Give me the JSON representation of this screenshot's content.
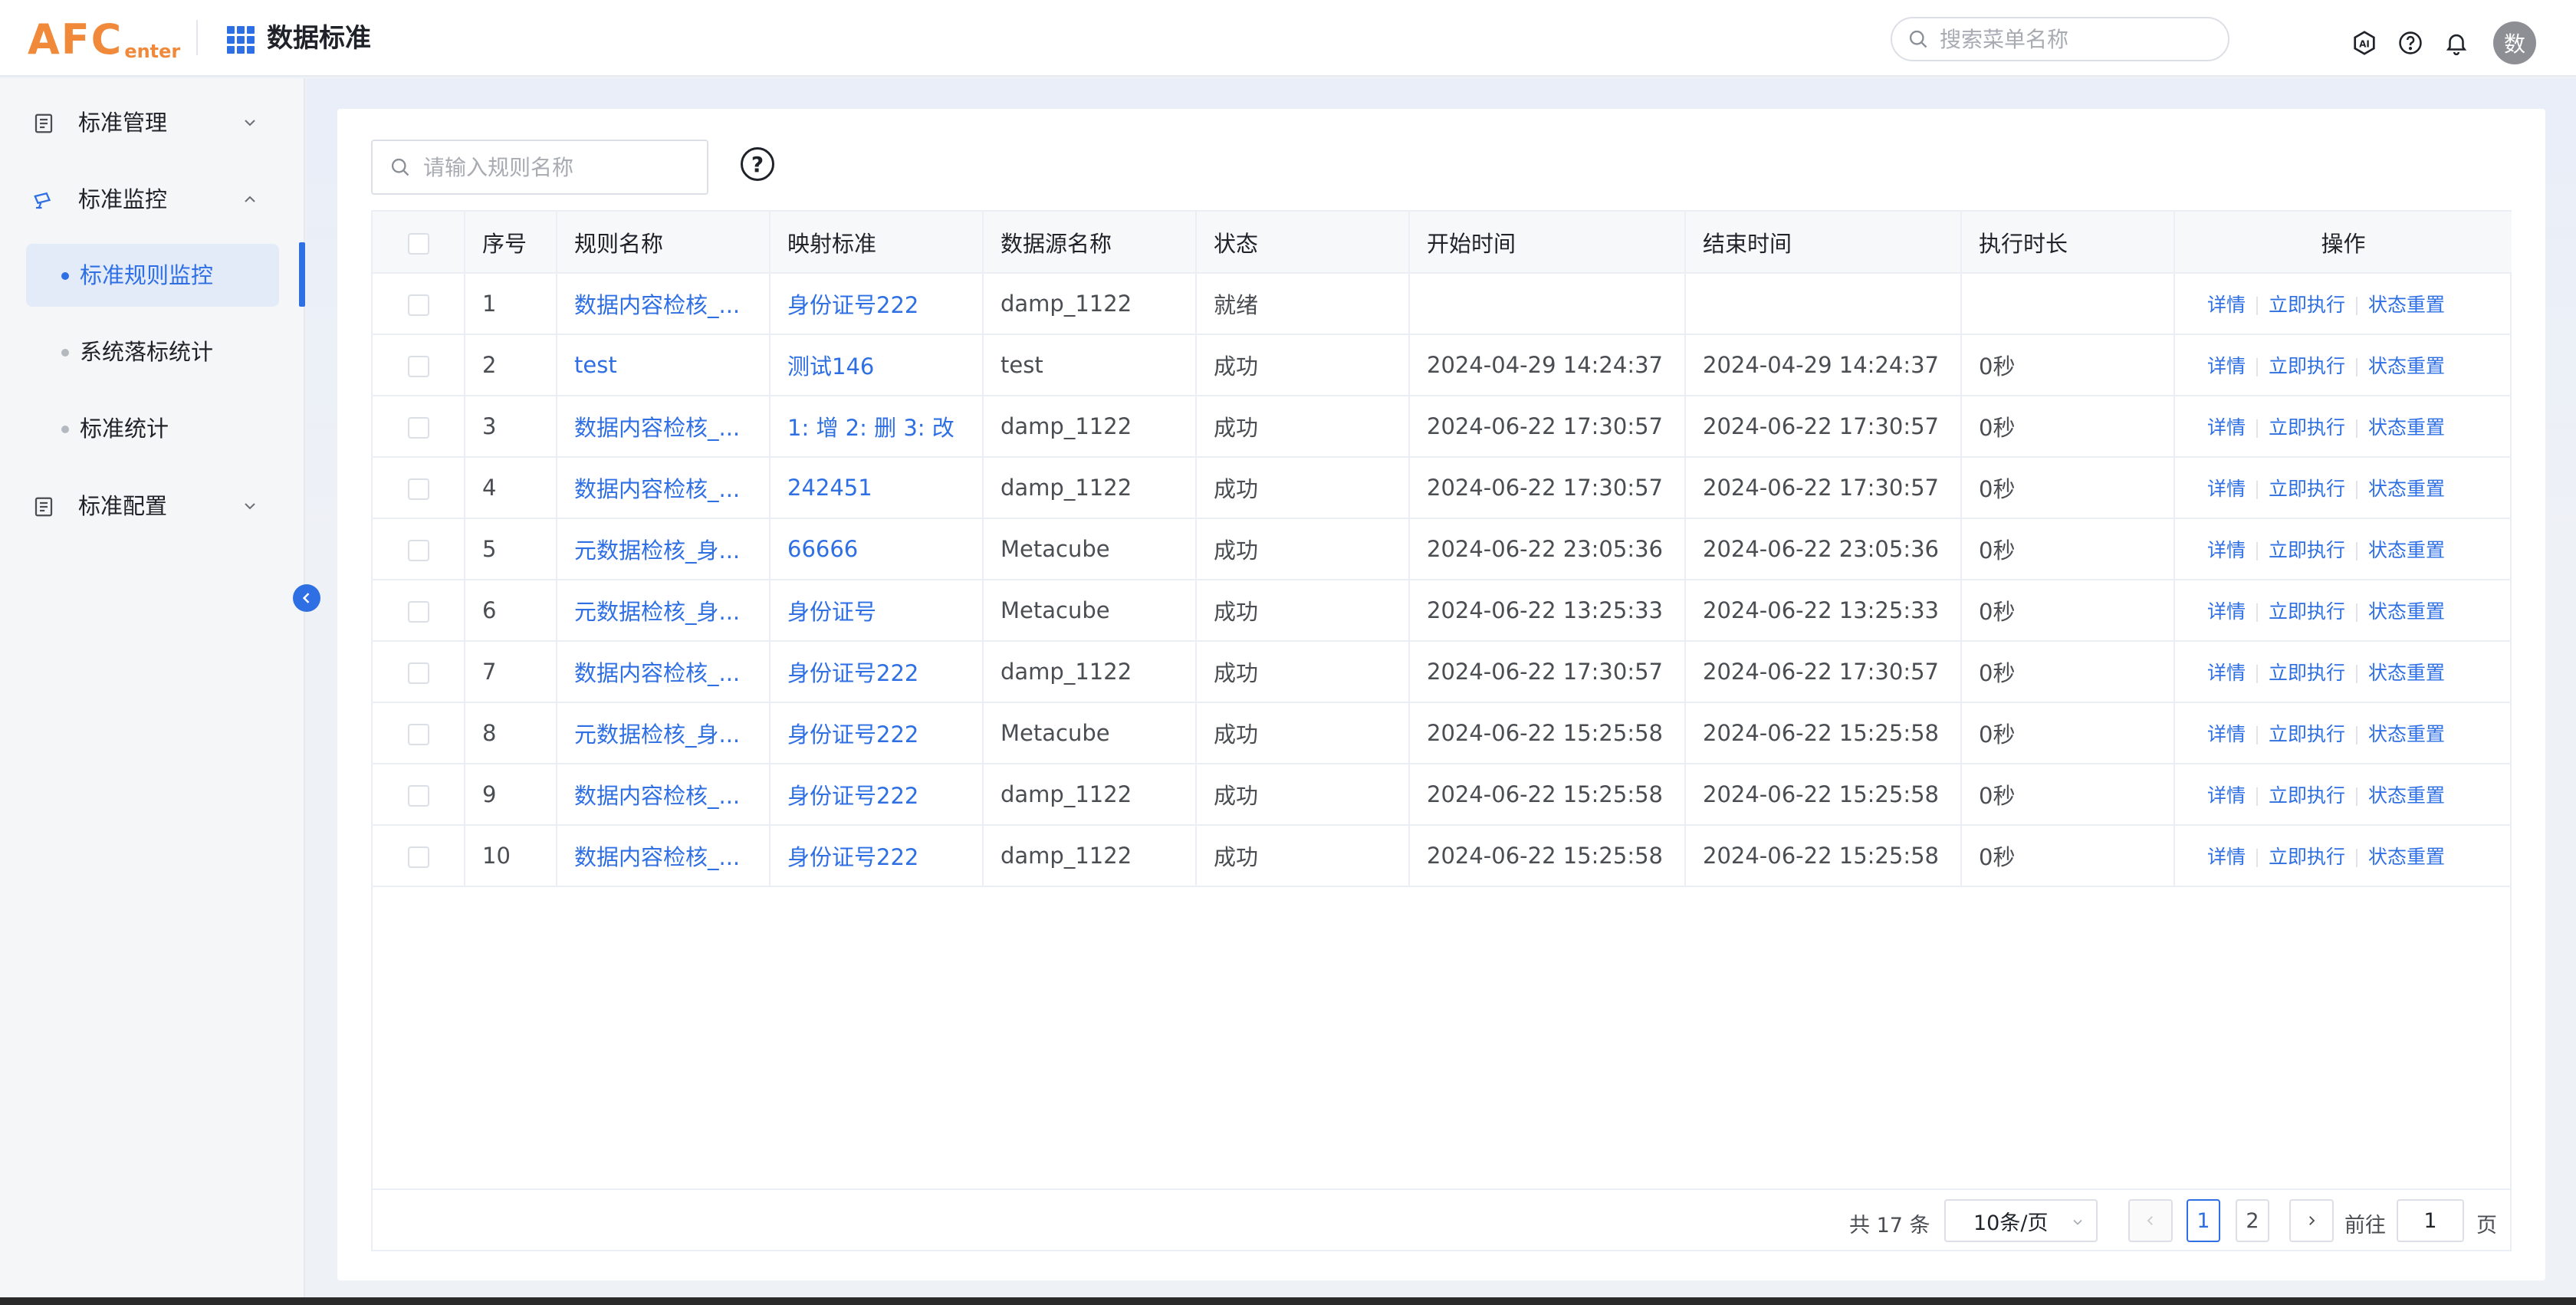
{
  "header": {
    "logo_main": "AFC",
    "logo_sub": "enter",
    "app_title": "数据标准",
    "search_placeholder": "搜索菜单名称",
    "icons": [
      "ai-icon",
      "help-icon",
      "bell-icon"
    ],
    "avatar_text": "数"
  },
  "sidebar": {
    "menus": [
      {
        "label": "标准管理",
        "icon": "document-icon",
        "expanded": false
      },
      {
        "label": "标准监控",
        "icon": "monitor-icon",
        "expanded": true
      },
      {
        "label": "标准配置",
        "icon": "document-icon",
        "expanded": false
      }
    ],
    "sub_items": [
      {
        "label": "标准规则监控",
        "active": true
      },
      {
        "label": "系统落标统计",
        "active": false
      },
      {
        "label": "标准统计",
        "active": false
      }
    ]
  },
  "toolbar": {
    "rule_search_placeholder": "请输入规则名称",
    "help_label": "?"
  },
  "table": {
    "columns": [
      "序号",
      "规则名称",
      "映射标准",
      "数据源名称",
      "状态",
      "开始时间",
      "结束时间",
      "执行时长",
      "操作"
    ],
    "actions": [
      "详情",
      "立即执行",
      "状态重置"
    ],
    "rows": [
      {
        "idx": "1",
        "rule": "数据内容检核_...",
        "standard": "身份证号222",
        "source": "damp_1122",
        "status": "就绪",
        "start": "",
        "end": "",
        "duration": ""
      },
      {
        "idx": "2",
        "rule": "test",
        "standard": "测试146",
        "source": "test",
        "status": "成功",
        "start": "2024-04-29 14:24:37",
        "end": "2024-04-29 14:24:37",
        "duration": "0秒"
      },
      {
        "idx": "3",
        "rule": "数据内容检核_...",
        "standard": "1: 增 2: 删 3: 改",
        "source": "damp_1122",
        "status": "成功",
        "start": "2024-06-22 17:30:57",
        "end": "2024-06-22 17:30:57",
        "duration": "0秒"
      },
      {
        "idx": "4",
        "rule": "数据内容检核_...",
        "standard": "242451",
        "source": "damp_1122",
        "status": "成功",
        "start": "2024-06-22 17:30:57",
        "end": "2024-06-22 17:30:57",
        "duration": "0秒"
      },
      {
        "idx": "5",
        "rule": "元数据检核_身...",
        "standard": "66666",
        "source": "Metacube",
        "status": "成功",
        "start": "2024-06-22 23:05:36",
        "end": "2024-06-22 23:05:36",
        "duration": "0秒"
      },
      {
        "idx": "6",
        "rule": "元数据检核_身...",
        "standard": "身份证号",
        "source": "Metacube",
        "status": "成功",
        "start": "2024-06-22 13:25:33",
        "end": "2024-06-22 13:25:33",
        "duration": "0秒"
      },
      {
        "idx": "7",
        "rule": "数据内容检核_...",
        "standard": "身份证号222",
        "source": "damp_1122",
        "status": "成功",
        "start": "2024-06-22 17:30:57",
        "end": "2024-06-22 17:30:57",
        "duration": "0秒"
      },
      {
        "idx": "8",
        "rule": "元数据检核_身...",
        "standard": "身份证号222",
        "source": "Metacube",
        "status": "成功",
        "start": "2024-06-22 15:25:58",
        "end": "2024-06-22 15:25:58",
        "duration": "0秒"
      },
      {
        "idx": "9",
        "rule": "数据内容检核_...",
        "standard": "身份证号222",
        "source": "damp_1122",
        "status": "成功",
        "start": "2024-06-22 15:25:58",
        "end": "2024-06-22 15:25:58",
        "duration": "0秒"
      },
      {
        "idx": "10",
        "rule": "数据内容检核_...",
        "standard": "身份证号222",
        "source": "damp_1122",
        "status": "成功",
        "start": "2024-06-22 15:25:58",
        "end": "2024-06-22 15:25:58",
        "duration": "0秒"
      }
    ]
  },
  "pagination": {
    "total_text": "共 17 条",
    "page_size": "10条/页",
    "pages": [
      "1",
      "2"
    ],
    "current_page": "1",
    "goto_label": "前往",
    "goto_value": "1",
    "page_unit": "页"
  },
  "colors": {
    "accent": "#2f6fe4",
    "logo": "#f0893a"
  }
}
